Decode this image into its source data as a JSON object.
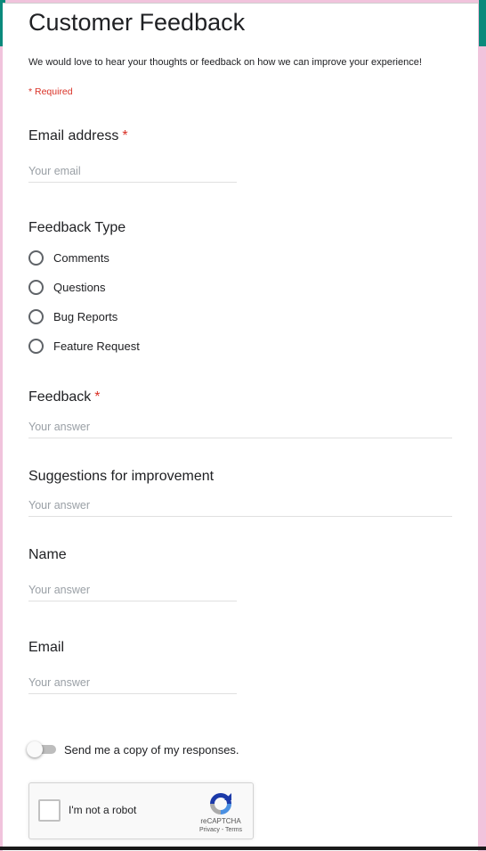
{
  "form": {
    "title": "Customer Feedback",
    "description": "We would love to hear your thoughts or feedback on how we can improve your experience!",
    "required_note": "* Required"
  },
  "questions": {
    "email_address": {
      "label": "Email address",
      "required_mark": "*",
      "placeholder": "Your email"
    },
    "feedback_type": {
      "label": "Feedback Type",
      "options": [
        "Comments",
        "Questions",
        "Bug Reports",
        "Feature Request"
      ]
    },
    "feedback": {
      "label": "Feedback",
      "required_mark": "*",
      "placeholder": "Your answer"
    },
    "suggestions": {
      "label": "Suggestions for improvement",
      "placeholder": "Your answer"
    },
    "name": {
      "label": "Name",
      "placeholder": "Your answer"
    },
    "email": {
      "label": "Email",
      "placeholder": "Your answer"
    }
  },
  "copy_toggle": {
    "label": "Send me a copy of my responses.",
    "on": false
  },
  "recaptcha": {
    "label": "I'm not a robot",
    "brand": "reCAPTCHA",
    "links": "Privacy - Terms"
  },
  "colors": {
    "header_accent": "#0b8a7c",
    "background": "#f1c3dc",
    "required": "#d93025"
  },
  "icons": {
    "recaptcha_logo": "recaptcha-logo-icon"
  }
}
